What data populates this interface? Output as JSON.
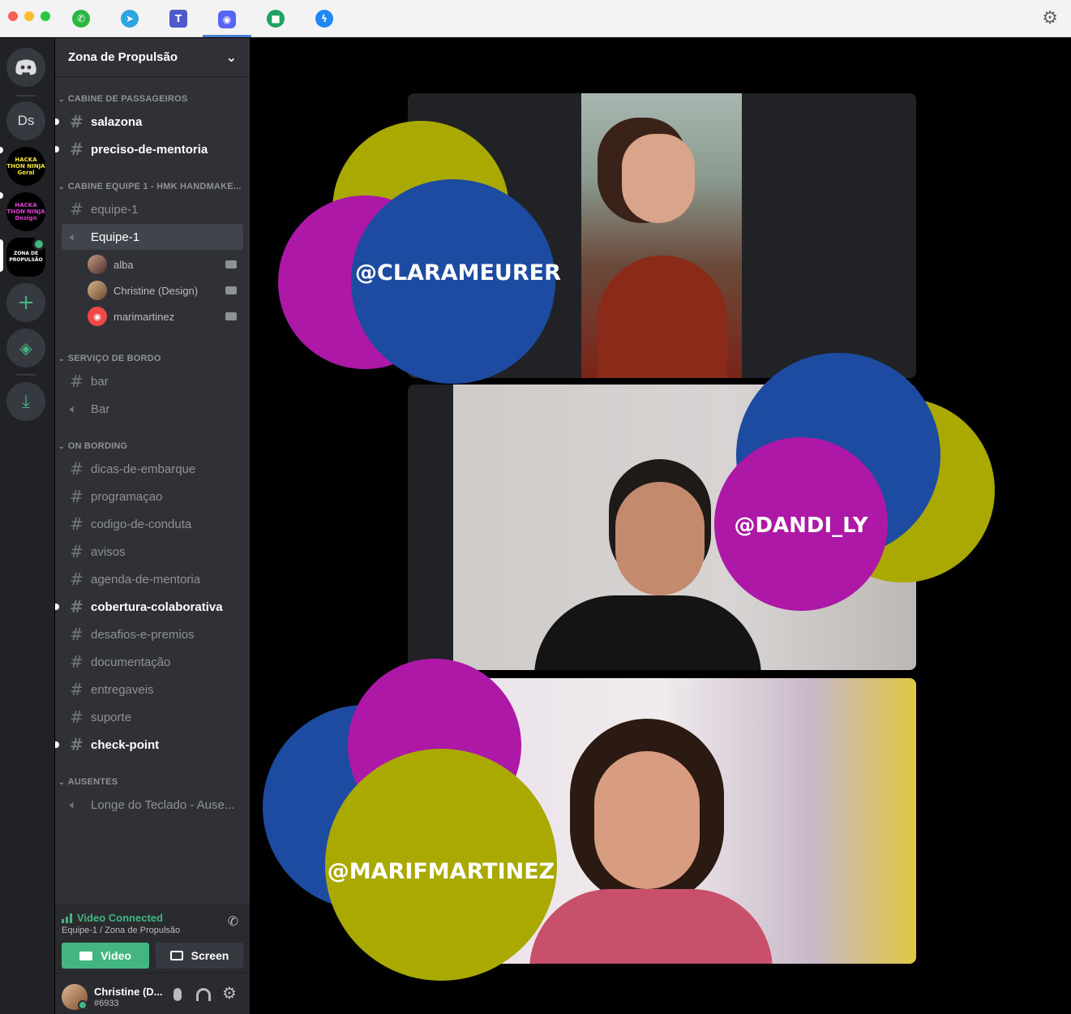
{
  "topbar": {
    "apps": [
      {
        "name": "whatsapp-icon",
        "glyph": "✆",
        "color": "#2cb742"
      },
      {
        "name": "telegram-icon",
        "glyph": "➤",
        "color": "#2ca5e0"
      },
      {
        "name": "teams-icon",
        "glyph": "T",
        "color": "#5059c9"
      },
      {
        "name": "discord-icon",
        "glyph": "◉",
        "color": "#5865f2"
      },
      {
        "name": "hangouts-icon",
        "glyph": "■",
        "color": "#1ea362"
      },
      {
        "name": "messenger-icon",
        "glyph": "ϟ",
        "color": "#1e88f5"
      }
    ],
    "settings_glyph": "⚙"
  },
  "servers": {
    "ds_label": "Ds",
    "hackathon_geral": "HACKA THON NINJA Geral",
    "hackathon_design": "HACKA THON NINJA Design",
    "zona": "ZONA DE PROPULSÃO",
    "add_glyph": "+",
    "explore_glyph": "◈",
    "download_glyph": "⤓"
  },
  "server_name": "Zona de Propulsão",
  "server_menu_glyph": "⌄",
  "categories": {
    "c1": "CABINE DE PASSAGEIROS",
    "c2": "CABINE EQUIPE 1 - HMK HANDMAKE...",
    "c3": "SERVIÇO DE BORDO",
    "c4": "ON BORDING",
    "c5": "AUSENTES"
  },
  "channels": {
    "salazona": "salazona",
    "preciso": "preciso-de-mentoria",
    "equipe1_text": "equipe-1",
    "equipe1_voice": "Equipe-1",
    "bar_text": "bar",
    "bar_voice": "Bar",
    "dicas": "dicas-de-embarque",
    "programacao": "programaçao",
    "codigo": "codigo-de-conduta",
    "avisos": "avisos",
    "agenda": "agenda-de-mentoria",
    "cobertura": "cobertura-colaborativa",
    "desafios": "desafios-e-premios",
    "documentacao": "documentação",
    "entregaveis": "entregaveis",
    "suporte": "suporte",
    "checkpoint": "check-point",
    "longe": "Longe do Teclado - Ause..."
  },
  "voice_users": [
    "alba",
    "Christine (Design)",
    "marimartinez"
  ],
  "voice_panel": {
    "status": "Video Connected",
    "location": "Equipe-1 / Zona de Propulsão",
    "video_label": "Video",
    "screen_label": "Screen"
  },
  "user_panel": {
    "name": "Christine (D...",
    "tag": "#6933"
  },
  "participants": [
    "@CLARAMEURER",
    "@DANDI_LY",
    "@MARIFMARTINEZ"
  ],
  "colors": {
    "olive": "#a9a902",
    "magenta": "#ad18a6",
    "blue": "#1d4ba1",
    "discord_green": "#43b581"
  }
}
